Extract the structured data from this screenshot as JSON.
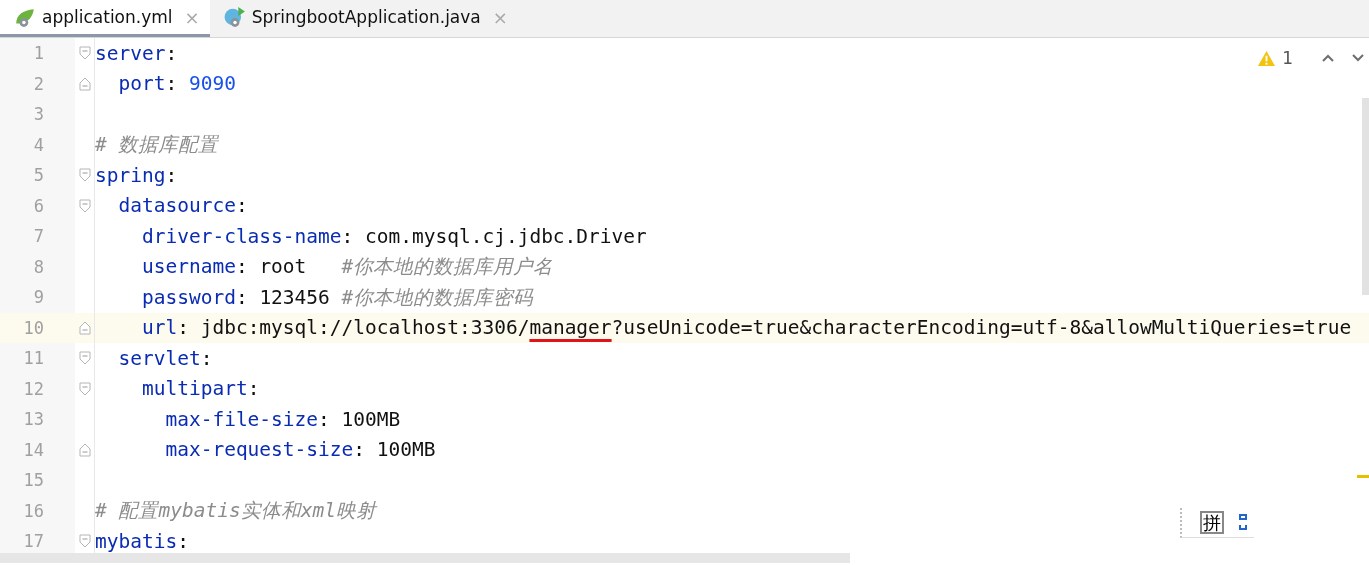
{
  "tabs": [
    {
      "label": "application.yml",
      "selected": true,
      "close": "×"
    },
    {
      "label": "SpringbootApplication.java",
      "selected": false,
      "close": "×"
    }
  ],
  "inspections": {
    "warnings": "1"
  },
  "lines": [
    {
      "number": "1",
      "kind": "start",
      "current": false,
      "segments": [
        {
          "kind": "key",
          "text": "server"
        },
        {
          "kind": "punct",
          "text": ":"
        }
      ]
    },
    {
      "number": "2",
      "kind": "end",
      "current": false,
      "segments": [
        {
          "kind": "key",
          "text": "  port"
        },
        {
          "kind": "punct",
          "text": ": "
        },
        {
          "kind": "number",
          "text": "9090"
        }
      ]
    },
    {
      "number": "3",
      "kind": "plain",
      "current": false
    },
    {
      "number": "4",
      "kind": "plain",
      "current": false,
      "segments": [
        {
          "kind": "comment",
          "text": "# 数据库配置"
        }
      ]
    },
    {
      "number": "5",
      "kind": "start",
      "current": false,
      "segments": [
        {
          "kind": "key",
          "text": "spring"
        },
        {
          "kind": "punct",
          "text": ":"
        }
      ]
    },
    {
      "number": "6",
      "kind": "start",
      "current": false,
      "segments": [
        {
          "kind": "key",
          "text": "  datasource"
        },
        {
          "kind": "punct",
          "text": ":"
        }
      ]
    },
    {
      "number": "7",
      "kind": "plain",
      "current": false,
      "segments": [
        {
          "kind": "key",
          "text": "    driver-class-name"
        },
        {
          "kind": "punct",
          "text": ": "
        },
        {
          "kind": "value",
          "text": "com.mysql.cj.jdbc.Driver"
        }
      ]
    },
    {
      "number": "8",
      "kind": "plain",
      "current": false,
      "segments": [
        {
          "kind": "key",
          "text": "    username"
        },
        {
          "kind": "punct",
          "text": ": "
        },
        {
          "kind": "value",
          "text": "root   "
        },
        {
          "kind": "comment",
          "text": "#你本地的数据库用户名"
        }
      ]
    },
    {
      "number": "9",
      "kind": "plain",
      "current": false,
      "segments": [
        {
          "kind": "key",
          "text": "    password"
        },
        {
          "kind": "punct",
          "text": ": "
        },
        {
          "kind": "value",
          "text": "123456 "
        },
        {
          "kind": "comment",
          "text": "#你本地的数据库密码"
        }
      ]
    },
    {
      "number": "10",
      "kind": "end",
      "current": true,
      "segments": [
        {
          "kind": "key",
          "text": "    url"
        },
        {
          "kind": "punct",
          "text": ": "
        },
        {
          "kind": "value",
          "text": "jdbc:mysql://localhost:3306/"
        },
        {
          "kind": "value",
          "text": "manager",
          "underlined": true
        },
        {
          "kind": "value",
          "text": "?useUnicode=true&characterEncoding=utf-8&allowMultiQueries=true"
        }
      ]
    },
    {
      "number": "11",
      "kind": "start",
      "current": false,
      "segments": [
        {
          "kind": "key",
          "text": "  servlet"
        },
        {
          "kind": "punct",
          "text": ":"
        }
      ]
    },
    {
      "number": "12",
      "kind": "start",
      "current": false,
      "segments": [
        {
          "kind": "key",
          "text": "    multipart"
        },
        {
          "kind": "punct",
          "text": ":"
        }
      ]
    },
    {
      "number": "13",
      "kind": "plain",
      "current": false,
      "segments": [
        {
          "kind": "key",
          "text": "      max-file-size"
        },
        {
          "kind": "punct",
          "text": ": "
        },
        {
          "kind": "value",
          "text": "100MB"
        }
      ]
    },
    {
      "number": "14",
      "kind": "end",
      "current": false,
      "segments": [
        {
          "kind": "key",
          "text": "      max-request-size"
        },
        {
          "kind": "punct",
          "text": ": "
        },
        {
          "kind": "value",
          "text": "100MB"
        }
      ]
    },
    {
      "number": "15",
      "kind": "plain",
      "current": false
    },
    {
      "number": "16",
      "kind": "plain",
      "current": false,
      "segments": [
        {
          "kind": "comment",
          "text": "# 配置mybatis实体和xml映射"
        }
      ]
    },
    {
      "number": "17",
      "kind": "start",
      "current": false,
      "segments": [
        {
          "kind": "key",
          "text": "mybatis"
        },
        {
          "kind": "punct",
          "text": ":"
        }
      ]
    }
  ],
  "ime_toolbar": {
    "mode": "拼"
  }
}
